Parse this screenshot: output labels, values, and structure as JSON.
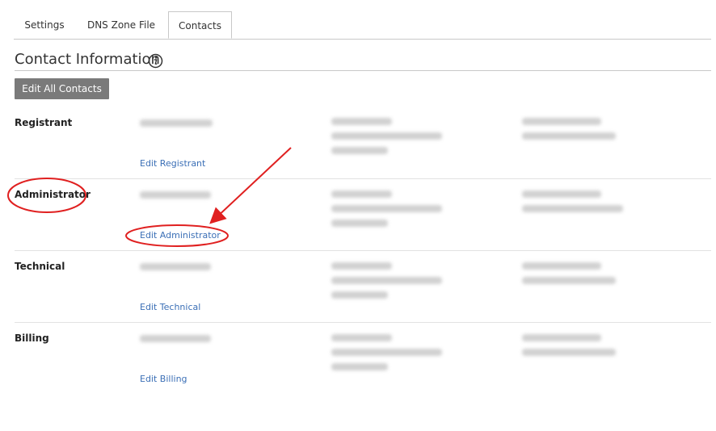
{
  "tabs": [
    {
      "label": "Settings",
      "active": false
    },
    {
      "label": "DNS Zone File",
      "active": false
    },
    {
      "label": "Contacts",
      "active": true
    }
  ],
  "section": {
    "title": "Contact Information",
    "edit_all_label": "Edit All Contacts"
  },
  "contacts": [
    {
      "role": "Registrant",
      "edit_label": "Edit Registrant"
    },
    {
      "role": "Administrator",
      "edit_label": "Edit Administrator"
    },
    {
      "role": "Technical",
      "edit_label": "Edit Technical"
    },
    {
      "role": "Billing",
      "edit_label": "Edit Billing"
    }
  ],
  "colors": {
    "link": "#3b6fb6",
    "annotation": "#e02020",
    "button_bg": "#7a7a7a"
  }
}
